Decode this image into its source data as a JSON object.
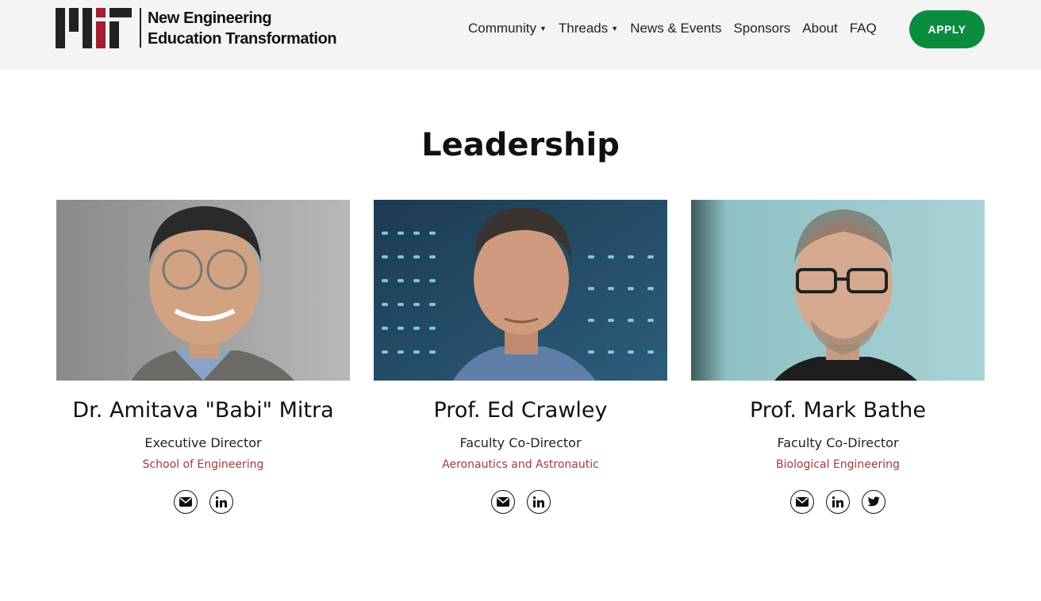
{
  "header": {
    "logo_line1": "New Engineering",
    "logo_line2": "Education Transformation",
    "nav": [
      {
        "label": "Community",
        "has_dropdown": true
      },
      {
        "label": "Threads",
        "has_dropdown": true
      },
      {
        "label": "News & Events",
        "has_dropdown": false
      },
      {
        "label": "Sponsors",
        "has_dropdown": false
      },
      {
        "label": "About",
        "has_dropdown": false
      },
      {
        "label": "FAQ",
        "has_dropdown": false
      }
    ],
    "apply_label": "APPLY",
    "apply_color": "#0a8c3f"
  },
  "section": {
    "title": "Leadership"
  },
  "people": [
    {
      "name": "Dr. Amitava \"Babi\" Mitra",
      "role": "Executive Director",
      "department": "School of Engineering",
      "socials": [
        "email-icon",
        "linkedin-icon"
      ]
    },
    {
      "name": "Prof. Ed Crawley",
      "role": "Faculty Co-Director",
      "department": "Aeronautics and Astronautic",
      "socials": [
        "email-icon",
        "linkedin-icon"
      ]
    },
    {
      "name": "Prof. Mark Bathe",
      "role": "Faculty Co-Director",
      "department": "Biological Engineering",
      "socials": [
        "email-icon",
        "linkedin-icon",
        "twitter-icon"
      ]
    }
  ],
  "colors": {
    "department_text": "#a33a3a",
    "mit_red": "#a31f34"
  }
}
